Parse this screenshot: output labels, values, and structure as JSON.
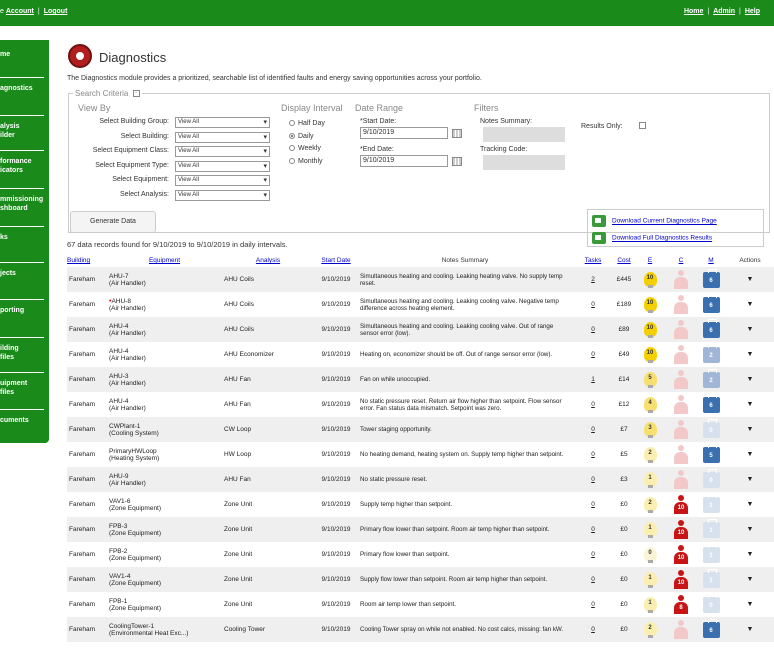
{
  "topbar": {
    "left_prefix": "e",
    "account": "Account",
    "logout": "Logout",
    "home": "Home",
    "admin": "Admin",
    "help": "Help"
  },
  "sidebar": {
    "items": [
      {
        "label": "me"
      },
      {
        "label": "agnostics"
      },
      {
        "label": "alysis\nilder"
      },
      {
        "label": "formance\nicators"
      },
      {
        "label": "mmissioning\nshboard"
      },
      {
        "label": "ks"
      },
      {
        "label": "jects"
      },
      {
        "label": "porting"
      },
      {
        "label": "ilding\nfiles"
      },
      {
        "label": "uipment\nfiles"
      },
      {
        "label": "cuments"
      }
    ]
  },
  "page": {
    "title": "Diagnostics",
    "intro": "The Diagnostics module provides a prioritized, searchable list of identified faults and energy saving opportunities across your portfolio."
  },
  "criteria": {
    "legend": "Search Criteria",
    "toggle": "-",
    "view_by": "View By",
    "interval_title": "Display Interval",
    "date_range_title": "Date Range",
    "filters_title": "Filters",
    "fields": [
      {
        "label": "Select Building Group:",
        "value": "View All"
      },
      {
        "label": "Select Building:",
        "value": "View All"
      },
      {
        "label": "Select Equipment Class:",
        "value": "View All"
      },
      {
        "label": "Select Equipment Type:",
        "value": "View All"
      },
      {
        "label": "Select Equipment:",
        "value": "View All"
      },
      {
        "label": "Select Analysis:",
        "value": "View All"
      }
    ],
    "intervals": [
      "Half Day",
      "Daily",
      "Weekly",
      "Monthly"
    ],
    "start_label": "*Start Date:",
    "start_value": "9/10/2019",
    "end_label": "*End Date:",
    "end_value": "9/10/2019",
    "notes_summary": "Notes Summary:",
    "tracking_code": "Tracking Code:",
    "results_only": "Results Only:"
  },
  "generate_label": "Generate Data",
  "downloads": {
    "current": "Download Current Diagnostics Page",
    "full": "Download Full Diagnostics Results"
  },
  "records_text": "67 data records found for 9/10/2019 to 9/10/2019 in daily intervals.",
  "table": {
    "headers": [
      "Building",
      "Equipment",
      "Analysis",
      "Start Date",
      "Notes Summary",
      "Tasks",
      "Cost",
      "E",
      "C",
      "M",
      "Actions"
    ],
    "rows": [
      {
        "building": "Fareham",
        "equipment": "AHU-7",
        "eq_type": "(Air Handler)",
        "analysis": "AHU Coils",
        "date": "9/10/2019",
        "notes": "Simultaneous heating and cooling. Leaking heating valve. No supply temp reset.",
        "tasks": "2",
        "cost": "£445",
        "e": "10",
        "c": "",
        "m": "6",
        "flag": false
      },
      {
        "building": "Fareham",
        "equipment": "AHU-8",
        "eq_type": "(Air Handler)",
        "analysis": "AHU Coils",
        "date": "9/10/2019",
        "notes": "Simultaneous heating and cooling. Leaking cooling valve. Negative temp difference across heating element.",
        "tasks": "0",
        "cost": "£189",
        "e": "10",
        "c": "",
        "m": "6",
        "flag": true
      },
      {
        "building": "Fareham",
        "equipment": "AHU-4",
        "eq_type": "(Air Handler)",
        "analysis": "AHU Coils",
        "date": "9/10/2019",
        "notes": "Simultaneous heating and cooling. Leaking cooling valve. Out of range sensor error (low).",
        "tasks": "0",
        "cost": "£89",
        "e": "10",
        "c": "",
        "m": "6",
        "flag": false
      },
      {
        "building": "Fareham",
        "equipment": "AHU-4",
        "eq_type": "(Air Handler)",
        "analysis": "AHU Economizer",
        "date": "9/10/2019",
        "notes": "Heating on, economizer should be off. Out of range sensor error (low).",
        "tasks": "0",
        "cost": "£49",
        "e": "10",
        "c": "",
        "m": "2",
        "flag": false
      },
      {
        "building": "Fareham",
        "equipment": "AHU-3",
        "eq_type": "(Air Handler)",
        "analysis": "AHU Fan",
        "date": "9/10/2019",
        "notes": "Fan on while unoccupied.",
        "tasks": "1",
        "cost": "£14",
        "e": "5",
        "c": "",
        "m": "2",
        "flag": false
      },
      {
        "building": "Fareham",
        "equipment": "AHU-4",
        "eq_type": "(Air Handler)",
        "analysis": "AHU Fan",
        "date": "9/10/2019",
        "notes": "No static pressure reset. Return air flow higher than setpoint. Flow sensor error. Fan status data mismatch. Setpoint was zero.",
        "tasks": "0",
        "cost": "£12",
        "e": "4",
        "c": "",
        "m": "6",
        "flag": false
      },
      {
        "building": "Fareham",
        "equipment": "CWPlant-1",
        "eq_type": "(Cooling System)",
        "analysis": "CW Loop",
        "date": "9/10/2019",
        "notes": "Tower staging opportunity.",
        "tasks": "0",
        "cost": "£7",
        "e": "3",
        "c": "",
        "m": "0",
        "flag": false
      },
      {
        "building": "Fareham",
        "equipment": "PrimaryHWLoop",
        "eq_type": "(Heating System)",
        "analysis": "HW Loop",
        "date": "9/10/2019",
        "notes": "No heating demand, heating system on. Supply temp higher than setpoint.",
        "tasks": "0",
        "cost": "£5",
        "e": "2",
        "c": "",
        "m": "5",
        "flag": false
      },
      {
        "building": "Fareham",
        "equipment": "AHU-9",
        "eq_type": "(Air Handler)",
        "analysis": "AHU Fan",
        "date": "9/10/2019",
        "notes": "No static pressure reset.",
        "tasks": "0",
        "cost": "£3",
        "e": "1",
        "c": "",
        "m": "0",
        "flag": false
      },
      {
        "building": "Fareham",
        "equipment": "VAV1-6",
        "eq_type": "(Zone Equipment)",
        "analysis": "Zone Unit",
        "date": "9/10/2019",
        "notes": "Supply temp higher than setpoint.",
        "tasks": "0",
        "cost": "£0",
        "e": "2",
        "c": "10",
        "m": "1",
        "flag": false
      },
      {
        "building": "Fareham",
        "equipment": "FPB-3",
        "eq_type": "(Zone Equipment)",
        "analysis": "Zone Unit",
        "date": "9/10/2019",
        "notes": "Primary flow lower than setpoint. Room air temp higher than setpoint.",
        "tasks": "0",
        "cost": "£0",
        "e": "1",
        "c": "10",
        "m": "1",
        "flag": false
      },
      {
        "building": "Fareham",
        "equipment": "FPB-2",
        "eq_type": "(Zone Equipment)",
        "analysis": "Zone Unit",
        "date": "9/10/2019",
        "notes": "Primary flow lower than setpoint.",
        "tasks": "0",
        "cost": "£0",
        "e": "0",
        "c": "10",
        "m": "1",
        "flag": false
      },
      {
        "building": "Fareham",
        "equipment": "VAV1-4",
        "eq_type": "(Zone Equipment)",
        "analysis": "Zone Unit",
        "date": "9/10/2019",
        "notes": "Supply flow lower than setpoint. Room air temp higher than setpoint.",
        "tasks": "0",
        "cost": "£0",
        "e": "1",
        "c": "10",
        "m": "1",
        "flag": false
      },
      {
        "building": "Fareham",
        "equipment": "FPB-1",
        "eq_type": "(Zone Equipment)",
        "analysis": "Zone Unit",
        "date": "9/10/2019",
        "notes": "Room air temp lower than setpoint.",
        "tasks": "0",
        "cost": "£0",
        "e": "1",
        "c": "8",
        "m": "0",
        "flag": false
      },
      {
        "building": "Fareham",
        "equipment": "CoolingTower-1",
        "eq_type": "(Environmental Heat Exc...)",
        "analysis": "Cooling Tower",
        "date": "9/10/2019",
        "notes": "Cooling Tower spray on while not enabled. No cost calcs, missing: fan kW.",
        "tasks": "0",
        "cost": "£0",
        "e": "2",
        "c": "",
        "m": "6",
        "flag": false
      }
    ],
    "action_glyph": "▼"
  },
  "colors": {
    "brand_green": "#1a8a1a",
    "link_blue": "#0000cc",
    "bulb_yellow": "#f5d000",
    "comfort_red": "#c81414",
    "maint_blue": "#3a6fb0"
  }
}
